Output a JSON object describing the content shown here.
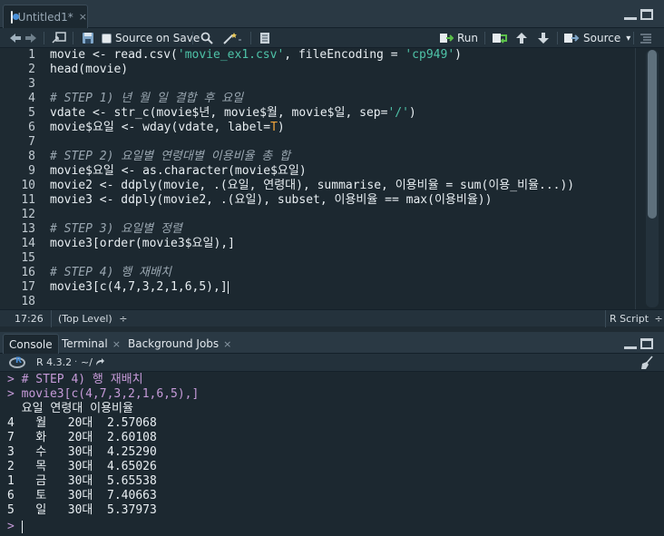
{
  "editor": {
    "tab": {
      "title": "Untitled1*",
      "close": "×"
    },
    "toolbar": {
      "source_on_save": "Source on Save",
      "run": "Run",
      "source": "Source",
      "dropdown_arrow": "▾"
    },
    "line_numbers": [
      "1",
      "2",
      "3",
      "4",
      "5",
      "6",
      "7",
      "8",
      "9",
      "10",
      "11",
      "12",
      "13",
      "14",
      "15",
      "16",
      "17",
      "18"
    ],
    "lines": [
      {
        "parts": [
          {
            "t": "movie <- read.csv(",
            "c": ""
          },
          {
            "t": "'movie_ex1.csv'",
            "c": "str"
          },
          {
            "t": ", fileEncoding = ",
            "c": ""
          },
          {
            "t": "'cp949'",
            "c": "str"
          },
          {
            "t": ")",
            "c": ""
          }
        ]
      },
      {
        "parts": [
          {
            "t": "head(movie)",
            "c": ""
          }
        ]
      },
      {
        "parts": [
          {
            "t": "",
            "c": ""
          }
        ]
      },
      {
        "parts": [
          {
            "t": "# STEP 1) 년 월 일 결합 후 요일",
            "c": "cm"
          }
        ]
      },
      {
        "parts": [
          {
            "t": "vdate <- str_c(movie$년, movie$월, movie$일, sep=",
            "c": ""
          },
          {
            "t": "'/'",
            "c": "str"
          },
          {
            "t": ")",
            "c": ""
          }
        ]
      },
      {
        "parts": [
          {
            "t": "movie$요일 <- wday(vdate, label=",
            "c": ""
          },
          {
            "t": "T",
            "c": "kw"
          },
          {
            "t": ")",
            "c": ""
          }
        ]
      },
      {
        "parts": [
          {
            "t": "",
            "c": ""
          }
        ]
      },
      {
        "parts": [
          {
            "t": "# STEP 2) 요일별 연령대별 이용비율 총 합",
            "c": "cm"
          }
        ]
      },
      {
        "parts": [
          {
            "t": "movie$요일 <- as.character(movie$요일)",
            "c": ""
          }
        ]
      },
      {
        "parts": [
          {
            "t": "movie2 <- ddply(movie, .(요일, 연령대), summarise, 이용비율 = sum(이용_비율...))",
            "c": ""
          }
        ]
      },
      {
        "parts": [
          {
            "t": "movie3 <- ddply(movie2, .(요일), subset, 이용비율 == max(이용비율))",
            "c": ""
          }
        ]
      },
      {
        "parts": [
          {
            "t": "",
            "c": ""
          }
        ]
      },
      {
        "parts": [
          {
            "t": "# STEP 3) 요일별 정렬",
            "c": "cm"
          }
        ]
      },
      {
        "parts": [
          {
            "t": "movie3[order(movie3$요일),]",
            "c": ""
          }
        ]
      },
      {
        "parts": [
          {
            "t": "",
            "c": ""
          }
        ]
      },
      {
        "parts": [
          {
            "t": "# STEP 4) 행 재배치",
            "c": "cm"
          }
        ]
      },
      {
        "parts": [
          {
            "t": "movie3[c(4,7,3,2,1,6,5),]",
            "c": ""
          }
        ]
      },
      {
        "parts": [
          {
            "t": "",
            "c": ""
          }
        ]
      }
    ],
    "status": {
      "position": "17:26",
      "scope": "(Top Level)",
      "filetype": "R Script",
      "arrows": "÷"
    }
  },
  "console": {
    "tabs": [
      {
        "label": "Console",
        "close": ""
      },
      {
        "label": "Terminal",
        "close": "×"
      },
      {
        "label": "Background Jobs",
        "close": "×"
      }
    ],
    "r_version": "R 4.3.2",
    "working_dir": "~/",
    "lines": [
      {
        "text": "> # STEP 4) 행 재배치",
        "echo": true
      },
      {
        "text": "> movie3[c(4,7,3,2,1,6,5),]",
        "echo": true
      },
      {
        "text": "  요일 연령대 이용비율",
        "echo": false
      },
      {
        "text": "4   월   20대  2.57068",
        "echo": false
      },
      {
        "text": "7   화   20대  2.60108",
        "echo": false
      },
      {
        "text": "3   수   30대  4.25290",
        "echo": false
      },
      {
        "text": "2   목   30대  4.65026",
        "echo": false
      },
      {
        "text": "1   금   30대  5.65538",
        "echo": false
      },
      {
        "text": "6   토   30대  7.40663",
        "echo": false
      },
      {
        "text": "5   일   30대  5.37973",
        "echo": false
      }
    ],
    "prompt": "> "
  },
  "colors": {
    "bg": "#1c2830",
    "string": "#4ec3a8",
    "comment": "#9aa7b1",
    "echo": "#c59ad8"
  }
}
